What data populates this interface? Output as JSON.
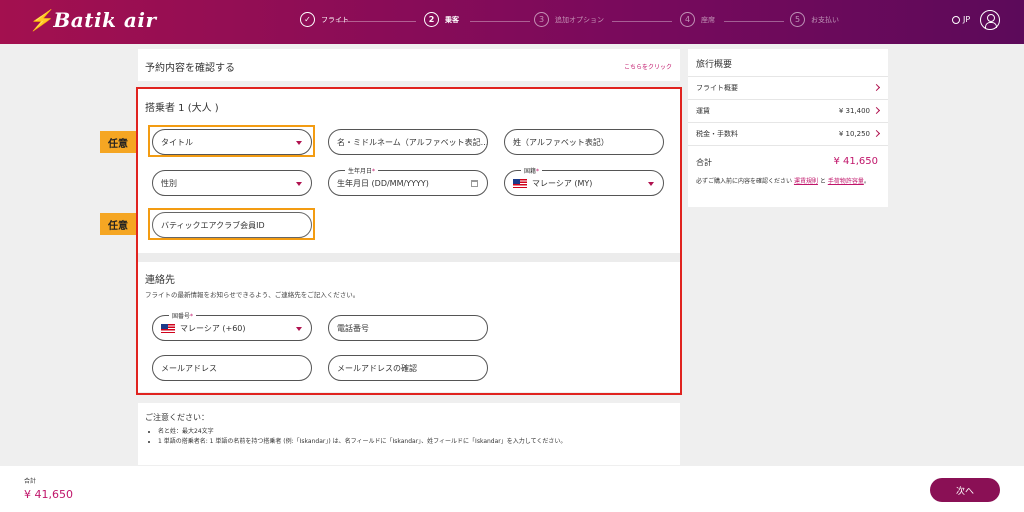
{
  "brand": {
    "logo_text": "Batik air",
    "accent": "#c0156a",
    "header_gradient": [
      "#a3104f",
      "#5c0a5a"
    ]
  },
  "steps": [
    {
      "num": "✓",
      "label": "フライト",
      "state": "done"
    },
    {
      "num": "2",
      "label": "乗客",
      "state": "active"
    },
    {
      "num": "3",
      "label": "追加オプション",
      "state": "pending"
    },
    {
      "num": "4",
      "label": "座席",
      "state": "pending"
    },
    {
      "num": "5",
      "label": "お支払い",
      "state": "pending"
    }
  ],
  "header": {
    "language": "JP"
  },
  "confirm": {
    "title": "予約内容を確認する",
    "link": "こちらをクリック"
  },
  "passenger": {
    "heading": "搭乗者 1 (大人 )",
    "title_placeholder": "タイトル",
    "first_name_placeholder": "名・ミドルネーム（アルファベット表記...",
    "last_name_placeholder": "姓（アルファベット表記）",
    "gender_placeholder": "性別",
    "dob_label": "生年月日",
    "dob_placeholder": "生年月日 (DD/MM/YYYY)",
    "nationality_label": "国籍",
    "nationality_value": "マレーシア (MY)",
    "member_id_placeholder": "バティックエアクラブ会員ID",
    "required_mark": "*"
  },
  "optional_tag": "任意",
  "contact": {
    "heading": "連絡先",
    "subtext": "フライトの最新情報をお知らせできるよう、ご連絡先をご記入ください。",
    "country_code_label": "国番号",
    "country_code_value": "マレーシア (+60)",
    "phone_placeholder": "電話番号",
    "email_placeholder": "メールアドレス",
    "email_confirm_placeholder": "メールアドレスの確認"
  },
  "notice": {
    "heading": "ご注意ください：",
    "items": [
      "名と姓：最大24文字",
      "1 単語の搭乗者名: 1 単語の名前を持つ搭乗者 (例:「Iskandar」) は、名フィールドに「Iskandar」、姓フィールドに「Iskandar」を入力してください。"
    ]
  },
  "summary": {
    "title": "旅行概要",
    "rows": [
      {
        "label": "フライト概要",
        "value": ""
      },
      {
        "label": "運賃",
        "value": "¥ 31,400"
      },
      {
        "label": "税金・手数料",
        "value": "¥ 10,250"
      }
    ],
    "total_label": "合計",
    "total_value": "¥ 41,650",
    "note_prefix": "必ずご購入前に内容を確認ください",
    "note_link1": "運賃規則",
    "note_and": "と",
    "note_link2": "手荷物許容量",
    "note_suffix": "。"
  },
  "footer": {
    "total_label": "合計",
    "total_value": "¥ 41,650",
    "next_label": "次へ"
  }
}
